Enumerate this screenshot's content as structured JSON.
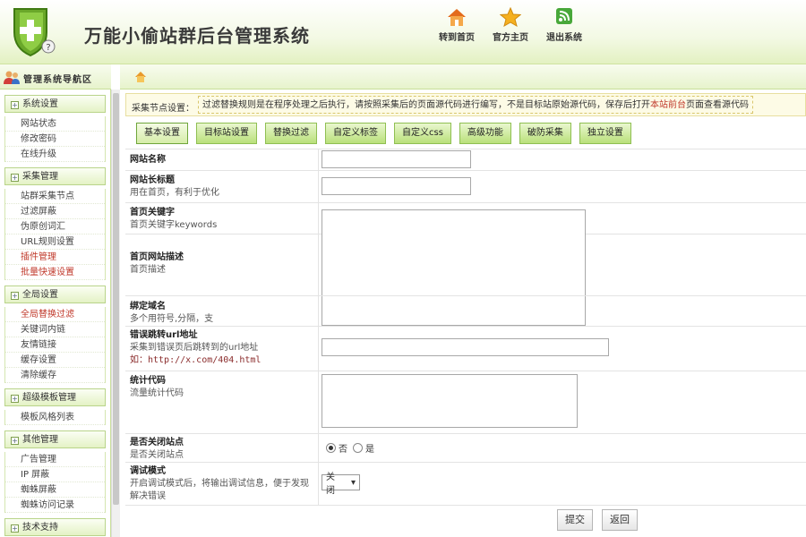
{
  "app": {
    "title": "万能小偷站群后台管理系统"
  },
  "topnav": [
    {
      "label": "转到首页",
      "icon": "home-icon"
    },
    {
      "label": "官方主页",
      "icon": "star-icon"
    },
    {
      "label": "退出系统",
      "icon": "rss-icon"
    }
  ],
  "sidebar": {
    "title": "管理系统导航区",
    "groups": [
      {
        "title": "系统设置",
        "items": [
          {
            "label": "网站状态"
          },
          {
            "label": "修改密码"
          },
          {
            "label": "在线升级"
          }
        ]
      },
      {
        "title": "采集管理",
        "items": [
          {
            "label": "站群采集节点"
          },
          {
            "label": "过滤屏蔽"
          },
          {
            "label": "伪原创词汇"
          },
          {
            "label": "URL规则设置"
          },
          {
            "label": "插件管理"
          },
          {
            "label": "批量快速设置"
          }
        ]
      },
      {
        "title": "全局设置",
        "items": [
          {
            "label": "全局替换过滤"
          },
          {
            "label": "关键词内链"
          },
          {
            "label": "友情链接"
          },
          {
            "label": "缓存设置"
          },
          {
            "label": "清除缓存"
          }
        ]
      },
      {
        "title": "超级模板管理",
        "items": [
          {
            "label": "模板风格列表"
          }
        ]
      },
      {
        "title": "其他管理",
        "items": [
          {
            "label": "广告管理"
          },
          {
            "label": "IP 屏蔽"
          },
          {
            "label": "蜘蛛屏蔽"
          },
          {
            "label": "蜘蛛访问记录"
          }
        ]
      },
      {
        "title": "技术支持",
        "items": []
      }
    ]
  },
  "notice": {
    "label": "采集节点设置：",
    "message_part1": "过滤替换规则是在程序处理之后执行，请按照采集后的页面源代码进行编写，不是目标站原始源代码，保存后打开",
    "message_highlight": "本站前台",
    "message_part2": "页面查看源代码"
  },
  "tabs": [
    {
      "label": "基本设置"
    },
    {
      "label": "目标站设置"
    },
    {
      "label": "替换过滤"
    },
    {
      "label": "自定义标签"
    },
    {
      "label": "自定义css"
    },
    {
      "label": "高级功能"
    },
    {
      "label": "破防采集"
    },
    {
      "label": "独立设置"
    }
  ],
  "form": {
    "site_name": {
      "label": "网站名称",
      "value": ""
    },
    "long_title": {
      "label": "网站长标题",
      "desc": "用在首页，有利于优化",
      "value": ""
    },
    "keywords": {
      "label": "首页关键字",
      "desc": "首页关键字keywords"
    },
    "description": {
      "label": "首页网站描述",
      "desc": "首页描述"
    },
    "domain": {
      "label": "绑定域名",
      "desc": "多个用符号,分隔，支"
    },
    "error_url": {
      "label": "错误跳转url地址",
      "desc": "采集到错误页后跳转到的url地址",
      "example": "如：http://x.com/404.html",
      "value": ""
    },
    "stats": {
      "label": "统计代码",
      "desc": "流量统计代码"
    },
    "close_site": {
      "label": "是否关闭站点",
      "desc": "是否关闭站点",
      "opt_no": "否",
      "opt_yes": "是",
      "selected": "否"
    },
    "debug": {
      "label": "调试模式",
      "desc": "开启调试模式后，将输出调试信息，便于发现解决错误",
      "value": "关闭"
    },
    "submit_label": "提交",
    "back_label": "返回"
  }
}
